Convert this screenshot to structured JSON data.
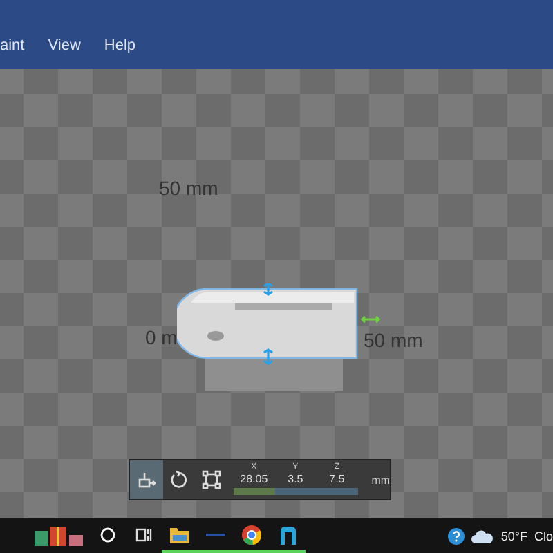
{
  "menu": [
    {
      "label": "aint"
    },
    {
      "label": "View"
    },
    {
      "label": "Help"
    }
  ],
  "viewport": {
    "labels": [
      "50 mm",
      "0 m",
      "50 mm"
    ]
  },
  "toolbar": {
    "tools": [
      {
        "kind": "move",
        "selected": true
      },
      {
        "kind": "rotate",
        "selected": false
      },
      {
        "kind": "scale",
        "selected": false
      }
    ],
    "coordinates": [
      {
        "axis": "X",
        "value": "28.05",
        "color": "#5e7a4a"
      },
      {
        "axis": "Y",
        "value": "3.5",
        "color": "#4a6478"
      },
      {
        "axis": "Z",
        "value": "7.5",
        "color": "#4a6478"
      }
    ],
    "unit": "mm"
  },
  "taskbar": {
    "apps": [
      {
        "kind": "gifts",
        "running": false
      },
      {
        "kind": "search",
        "running": false
      },
      {
        "kind": "taskview",
        "running": false
      },
      {
        "kind": "files",
        "running": true
      },
      {
        "kind": "dash",
        "running": true
      },
      {
        "kind": "browser",
        "running": true
      },
      {
        "kind": "builder",
        "running": true
      }
    ],
    "temperature": "50°F",
    "condition": "Clo"
  }
}
